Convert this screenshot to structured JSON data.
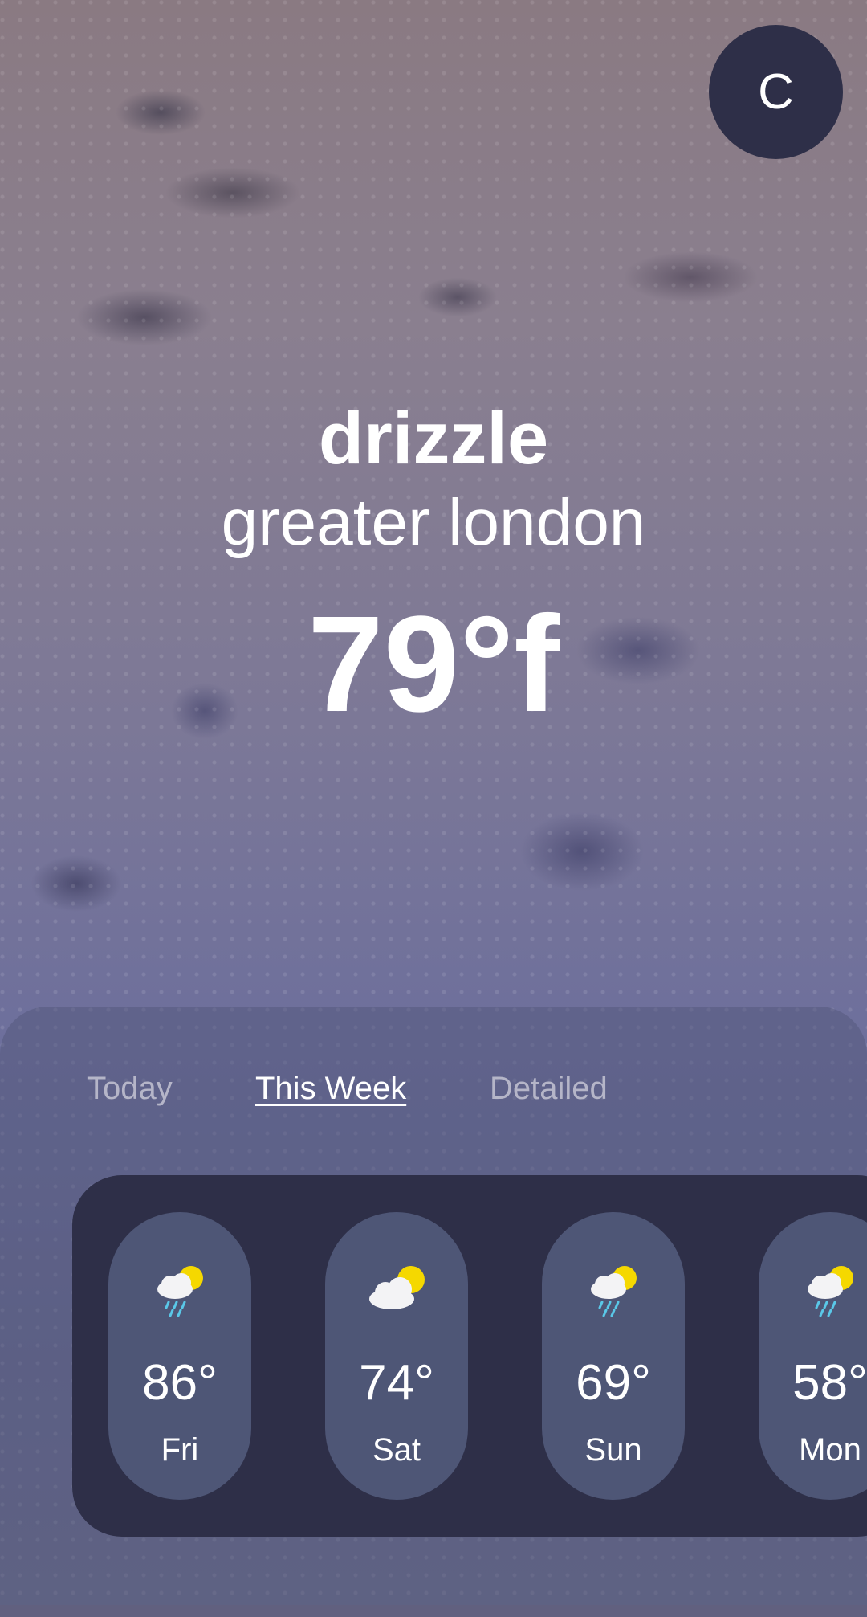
{
  "profile": {
    "initial": "C"
  },
  "current": {
    "condition": "drizzle",
    "location": "greater london",
    "temperature": "79°f"
  },
  "tabs": [
    {
      "label": "Today",
      "active": false
    },
    {
      "label": "This Week",
      "active": true
    },
    {
      "label": "Detailed",
      "active": false
    }
  ],
  "forecast": [
    {
      "temp": "86°",
      "day": "Fri",
      "icon": "sun-cloud-rain-icon"
    },
    {
      "temp": "74°",
      "day": "Sat",
      "icon": "sun-cloud-icon"
    },
    {
      "temp": "69°",
      "day": "Sun",
      "icon": "sun-cloud-rain-icon"
    },
    {
      "temp": "58°",
      "day": "Mon",
      "icon": "sun-cloud-rain-icon"
    }
  ],
  "colors": {
    "avatar_bg": "#2e2f48",
    "card_bg": "#2e2f48",
    "pill_bg": "#4e5676",
    "sun": "#f5d800",
    "rain": "#5ac8e8"
  }
}
